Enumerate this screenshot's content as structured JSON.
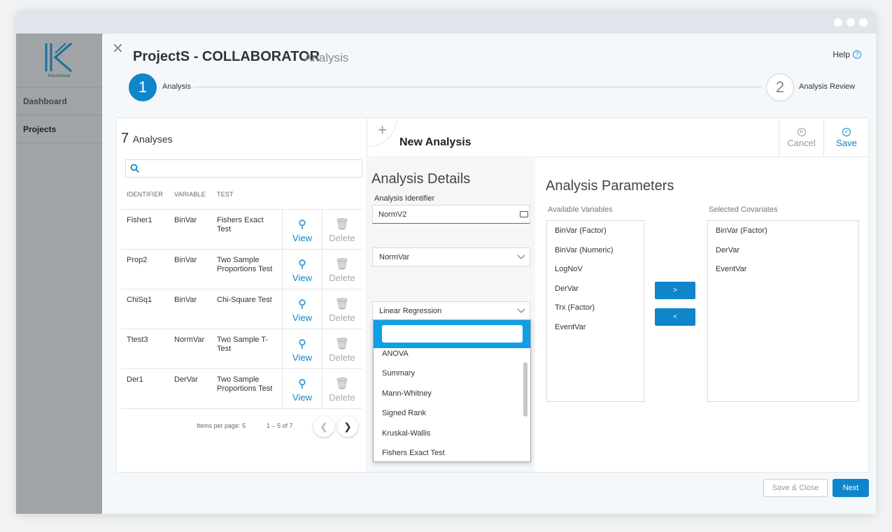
{
  "sidebar": {
    "logo_text": "KerusCloud",
    "items": [
      {
        "label": "Dashboard"
      },
      {
        "label": "Projects"
      }
    ]
  },
  "header": {
    "title": "ProjectS - COLLABORATOR",
    "subtitle": "Analysis",
    "help_label": "Help"
  },
  "stepper": {
    "step1_number": "1",
    "step1_label": "Analysis",
    "step2_number": "2",
    "step2_label": "Analysis Review"
  },
  "analyses": {
    "count": "7",
    "count_label": "Analyses",
    "columns": [
      "IDENTIFIER",
      "VARIABLE",
      "TEST"
    ],
    "view_label": "View",
    "delete_label": "Delete",
    "rows": [
      {
        "id": "Fisher1",
        "variable": "BinVar",
        "test": "Fishers Exact Test"
      },
      {
        "id": "Prop2",
        "variable": "BinVar",
        "test": "Two Sample Proportions Test"
      },
      {
        "id": "ChiSq1",
        "variable": "BinVar",
        "test": "Chi-Square Test"
      },
      {
        "id": "Ttest3",
        "variable": "NormVar",
        "test": "Two Sample T-Test"
      },
      {
        "id": "Der1",
        "variable": "DerVar",
        "test": "Two Sample Proportions Test"
      }
    ],
    "items_per_page": "Items per page: 5",
    "range": "1 – 5 of 7"
  },
  "toolbar": {
    "plus": "+",
    "new_title": "New Analysis",
    "cancel_label": "Cancel",
    "save_label": "Save"
  },
  "details": {
    "title": "Analysis Details",
    "identifier_label": "Analysis Identifier",
    "identifier_value": "NormV2",
    "variable_value": "NormVar",
    "test_value": "Linear Regression",
    "test_options": [
      "ANOVA",
      "Summary",
      "Mann-Whitney",
      "Signed Rank",
      "Kruskal-Wallis",
      "Fishers Exact Test"
    ]
  },
  "params": {
    "title": "Analysis Parameters",
    "available_label": "Available Variables",
    "selected_label": "Selected Covariates",
    "available": [
      "BinVar (Factor)",
      "BinVar (Numeric)",
      "LogNoV",
      "DerVar",
      "Trx (Factor)",
      "EventVar"
    ],
    "selected": [
      "BinVar (Factor)",
      "DerVar",
      "EventVar"
    ],
    "add_label": ">",
    "remove_label": "<"
  },
  "footer": {
    "save_close_label": "Save & Close",
    "next_label": "Next"
  },
  "colors": {
    "accent": "#0f86c9",
    "dropdown_header": "#0f9fe5",
    "sidebar": "#a1a4a7"
  }
}
